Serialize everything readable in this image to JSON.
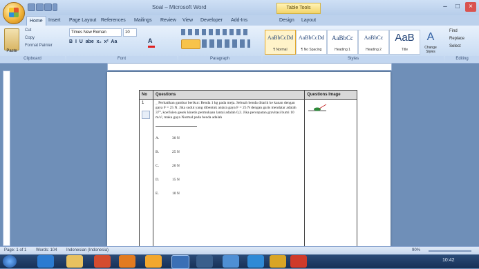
{
  "window": {
    "title": "Soal – Microsoft Word",
    "context_tab": "Table Tools"
  },
  "tabs": [
    "Home",
    "Insert",
    "Page Layout",
    "References",
    "Mailings",
    "Review",
    "View",
    "Developer",
    "Add-Ins",
    "Design",
    "Layout"
  ],
  "ribbon": {
    "font_name": "Times New Roman",
    "font_size": "10",
    "clipboard": {
      "paste": "Paste",
      "cut": "Cut",
      "copy": "Copy",
      "format_painter": "Format Painter"
    },
    "groups": [
      "Clipboard",
      "Font",
      "Paragraph",
      "Styles",
      "Editing"
    ],
    "styles": [
      {
        "sample": "AaBbCcDd",
        "name": "¶ Normal"
      },
      {
        "sample": "AaBbCcDd",
        "name": "¶ No Spacing"
      },
      {
        "sample": "AaBbCc",
        "name": "Heading 1"
      },
      {
        "sample": "AaBbCc",
        "name": "Heading 2"
      },
      {
        "sample": "AaB",
        "name": "Title"
      }
    ],
    "change_styles": "Change Styles",
    "editing": [
      "Find",
      "Replace",
      "Select"
    ]
  },
  "document": {
    "table_headers": [
      "No",
      "Questions",
      "Questions Image"
    ],
    "question_number": "1",
    "question_text": "_ Perhatikan gambar berikut: Benda 1 kg pada meja. Sebuah benda ditarik ke kanan dengan gaya F = 25 N. Jika sudut yang dibentuk antara gaya F = 25 N dengan garis mendatar adalah 37°, koefisien gesek kinetis permukaan lantai adalah 0,2. Jika percepatan gravitasi bumi 10 m/s², maka gaya Normal pada benda adalah",
    "options": [
      {
        "letter": "A.",
        "text": "30 N"
      },
      {
        "letter": "B.",
        "text": "25 N"
      },
      {
        "letter": "C.",
        "text": "20 N"
      },
      {
        "letter": "D.",
        "text": "15 N"
      },
      {
        "letter": "E.",
        "text": "10 N"
      }
    ]
  },
  "statusbar": {
    "page": "Page: 1 of 1",
    "words": "Words: 104",
    "language": "Indonesian (Indonesia)",
    "zoom": "90%"
  },
  "taskbar": {
    "time": "10:42"
  }
}
